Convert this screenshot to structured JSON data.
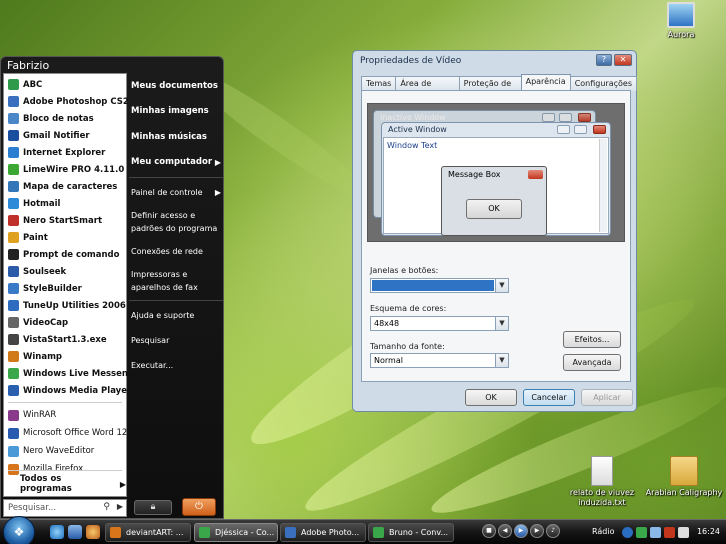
{
  "colors": {
    "accent": "#3c7fb1",
    "start_orb": "#1f5fa5",
    "selected_swatch": "#2f74c4",
    "close_red": "#c2361e"
  },
  "start_menu": {
    "user_name": "Fabrizio",
    "pinned": [
      {
        "label": "ABC",
        "icon": "green-circle-icon",
        "color": "#2f9a4a"
      },
      {
        "label": "Adobe Photoshop CS2",
        "icon": "photoshop-icon",
        "color": "#3a6fbf"
      },
      {
        "label": "Bloco de notas",
        "icon": "notepad-icon",
        "color": "#4a86c8"
      },
      {
        "label": "Gmail Notifier",
        "icon": "gmail-icon",
        "color": "#1a4fa0"
      },
      {
        "label": "Internet Explorer",
        "icon": "internet-explorer-icon",
        "color": "#2c7fd0"
      },
      {
        "label": "LimeWire PRO 4.11.0",
        "icon": "limewire-icon",
        "color": "#3aa832"
      },
      {
        "label": "Mapa de caracteres",
        "icon": "character-map-icon",
        "color": "#3477b8"
      },
      {
        "label": "Hotmail",
        "icon": "hotmail-icon",
        "color": "#2d8ad8"
      },
      {
        "label": "Nero StartSmart",
        "icon": "nero-icon",
        "color": "#c0302a"
      },
      {
        "label": "Paint",
        "icon": "paint-icon",
        "color": "#e0a020"
      },
      {
        "label": "Prompt de comando",
        "icon": "command-prompt-icon",
        "color": "#222222"
      },
      {
        "label": "Soulseek",
        "icon": "soulseek-icon",
        "color": "#2a5aa8"
      },
      {
        "label": "StyleBuilder",
        "icon": "stylebuilder-icon",
        "color": "#3a78c8"
      },
      {
        "label": "TuneUp Utilities 2006",
        "icon": "tuneup-icon",
        "color": "#2f6cc0"
      },
      {
        "label": "VideoCap",
        "icon": "videocap-icon",
        "color": "#666666"
      },
      {
        "label": "VistaStart1.3.exe",
        "icon": "vistastart-icon",
        "color": "#444444"
      },
      {
        "label": "Winamp",
        "icon": "winamp-icon",
        "color": "#d07a1a"
      },
      {
        "label": "Windows Live Messenger",
        "icon": "messenger-icon",
        "color": "#3aa84a"
      },
      {
        "label": "Windows Media Player",
        "icon": "media-player-icon",
        "color": "#2a5fb0"
      }
    ],
    "recent": [
      {
        "label": "WinRAR",
        "icon": "winrar-icon",
        "color": "#8a3a8a"
      },
      {
        "label": "Microsoft Office Word 12",
        "icon": "word-icon",
        "color": "#2a5ab0"
      },
      {
        "label": "Nero WaveEditor",
        "icon": "nero-wave-icon",
        "color": "#4a9ad8"
      },
      {
        "label": "Mozilla Firefox",
        "icon": "firefox-icon",
        "color": "#d8741a"
      }
    ],
    "all_programs": "Todos os programas",
    "search_placeholder": "Pesquisar...",
    "right": {
      "documents": "Meus documentos",
      "pictures": "Minhas imagens",
      "music": "Minhas músicas",
      "computer": "Meu computador",
      "control_panel": "Painel de controle",
      "defaults": "Definir acesso e padrões do programa",
      "network": "Conexões de rede",
      "printers": "Impressoras e aparelhos de fax",
      "help": "Ajuda e suporte",
      "search": "Pesquisar",
      "run": "Executar..."
    }
  },
  "dialog": {
    "title": "Propriedades de Vídeo",
    "tabs": [
      {
        "label": "Temas"
      },
      {
        "label": "Área de trabalho"
      },
      {
        "label": "Proteção de tela"
      },
      {
        "label": "Aparência"
      },
      {
        "label": "Configurações"
      }
    ],
    "preview": {
      "inactive": "Inactive Window",
      "active": "Active Window",
      "window_text": "Window Text",
      "message_box": "Message Box",
      "ok": "OK"
    },
    "windows_buttons_label": "Janelas e botões:",
    "windows_buttons_value": "",
    "color_scheme_label": "Esquema de cores:",
    "color_scheme_value": "48x48",
    "font_size_label": "Tamanho da fonte:",
    "font_size_value": "Normal",
    "effects": "Efeitos...",
    "advanced": "Avançada",
    "ok": "OK",
    "cancel": "Cancelar",
    "apply": "Aplicar"
  },
  "desktop": {
    "aurora": "Aurora",
    "file1": "relato de viuvez induzida.txt",
    "folder1": "Arabian Caligraphy"
  },
  "taskbar": {
    "tasks": [
      {
        "label": "deviantART: ...",
        "icon": "firefox-icon",
        "color": "#d8741a"
      },
      {
        "label": "Djéssica - Co...",
        "icon": "messenger-icon",
        "color": "#3aa84a"
      },
      {
        "label": "Adobe Photo...",
        "icon": "photoshop-icon",
        "color": "#3a6fbf"
      },
      {
        "label": "Bruno - Conv...",
        "icon": "messenger-icon",
        "color": "#3aa84a"
      }
    ],
    "radio": "Rádio",
    "clock": "16:24"
  }
}
